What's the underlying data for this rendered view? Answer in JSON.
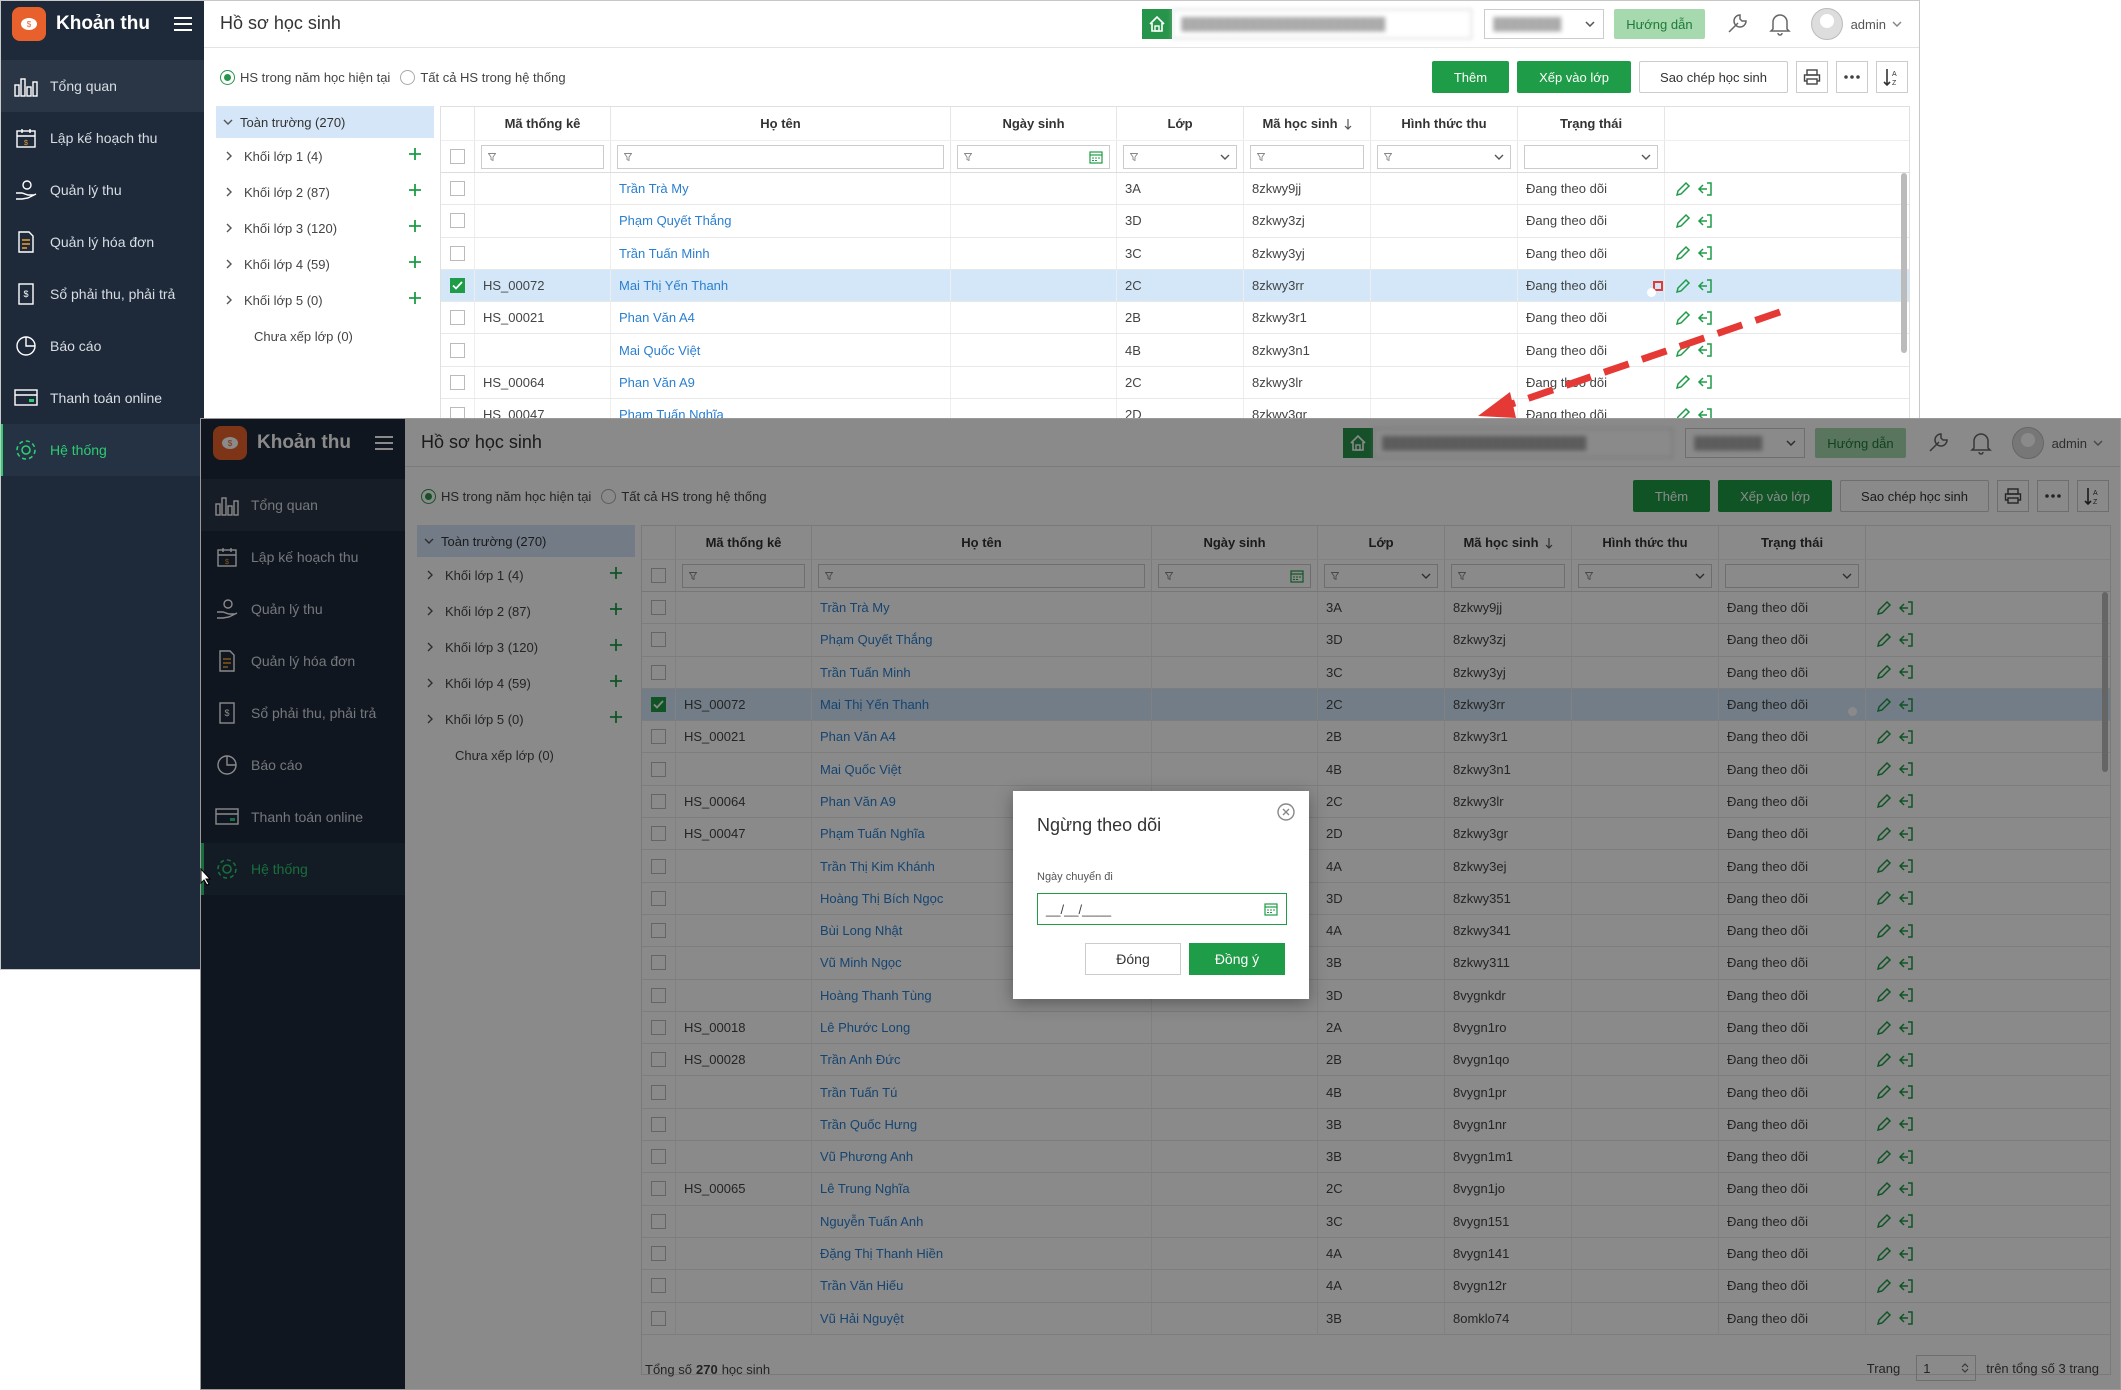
{
  "app": {
    "name": "Khoản thu"
  },
  "nav": [
    {
      "label": "Tổng quan",
      "icon": "bar-chart-icon"
    },
    {
      "label": "Lập kế hoạch thu",
      "icon": "calendar-icon"
    },
    {
      "label": "Quản lý thu",
      "icon": "hand-coin-icon"
    },
    {
      "label": "Quản lý hóa đơn",
      "icon": "invoice-icon"
    },
    {
      "label": "Sổ phải thu, phải trả",
      "icon": "ledger-icon"
    },
    {
      "label": "Báo cáo",
      "icon": "pie-chart-icon"
    },
    {
      "label": "Thanh toán online",
      "icon": "card-icon"
    },
    {
      "label": "Hệ thống",
      "icon": "gear-icon"
    }
  ],
  "header": {
    "title": "Hồ sơ học sinh",
    "guide": "Hướng dẫn",
    "user": "admin"
  },
  "filters": {
    "current_year": "HS trong năm học hiện tại",
    "all": "Tất cả HS trong hệ thống"
  },
  "actions": {
    "add": "Thêm",
    "assign": "Xếp vào lớp",
    "copy": "Sao chép học sinh"
  },
  "tree": {
    "root": "Toàn trường (270)",
    "nodes": [
      "Khối lớp 1 (4)",
      "Khối lớp 2 (87)",
      "Khối lớp 3 (120)",
      "Khối lớp 4 (59)",
      "Khối lớp 5 (0)"
    ],
    "unassigned": "Chưa xếp lớp (0)"
  },
  "columns": [
    "Mã thống kê",
    "Họ tên",
    "Ngày sinh",
    "Lớp",
    "Mã học sinh",
    "Hình thức thu",
    "Trạng thái"
  ],
  "status_text": "Đang theo dõi",
  "rows": [
    {
      "code": "",
      "name": "Trần Trà My",
      "cls": "3A",
      "sid": "8zkwy9jj"
    },
    {
      "code": "",
      "name": "Phạm Quyết Thắng",
      "cls": "3D",
      "sid": "8zkwy3zj"
    },
    {
      "code": "",
      "name": "Trần Tuấn Minh",
      "cls": "3C",
      "sid": "8zkwy3yj"
    },
    {
      "code": "HS_00072",
      "name": "Mai Thị Yến Thanh",
      "cls": "2C",
      "sid": "8zkwy3rr",
      "selected": true
    },
    {
      "code": "HS_00021",
      "name": "Phan Văn A4",
      "cls": "2B",
      "sid": "8zkwy3r1"
    },
    {
      "code": "",
      "name": "Mai Quốc Việt",
      "cls": "4B",
      "sid": "8zkwy3n1"
    },
    {
      "code": "HS_00064",
      "name": "Phan Văn A9",
      "cls": "2C",
      "sid": "8zkwy3lr"
    },
    {
      "code": "HS_00047",
      "name": "Phạm Tuấn Nghĩa",
      "cls": "2D",
      "sid": "8zkwy3gr"
    },
    {
      "code": "",
      "name": "Trần Thị Kim Khánh",
      "cls": "4A",
      "sid": "8zkwy3ej"
    },
    {
      "code": "",
      "name": "Hoàng Thị Bích Ngọc",
      "cls": "3D",
      "sid": "8zkwy351"
    },
    {
      "code": "",
      "name": "Bùi Long Nhật",
      "cls": "4A",
      "sid": "8zkwy341"
    },
    {
      "code": "",
      "name": "Vũ Minh Ngọc",
      "cls": "3B",
      "sid": "8zkwy311"
    },
    {
      "code": "",
      "name": "Hoàng Thanh Tùng",
      "cls": "3D",
      "sid": "8vygnkdr"
    },
    {
      "code": "HS_00018",
      "name": "Lê Phước Long",
      "cls": "2A",
      "sid": "8vygn1ro"
    },
    {
      "code": "HS_00028",
      "name": "Trần Anh Đức",
      "cls": "2B",
      "sid": "8vygn1qo"
    },
    {
      "code": "",
      "name": "Trần Tuấn Tú",
      "cls": "4B",
      "sid": "8vygn1pr"
    },
    {
      "code": "",
      "name": "Trần Quốc Hưng",
      "cls": "3B",
      "sid": "8vygn1nr"
    },
    {
      "code": "",
      "name": "Vũ Phương Anh",
      "cls": "3B",
      "sid": "8vygn1m1"
    },
    {
      "code": "HS_00065",
      "name": "Lê Trung Nghĩa",
      "cls": "2C",
      "sid": "8vygn1jo"
    },
    {
      "code": "",
      "name": "Nguyễn Tuấn Anh",
      "cls": "3C",
      "sid": "8vygn151"
    },
    {
      "code": "",
      "name": "Đặng Thị Thanh Hiền",
      "cls": "4A",
      "sid": "8vygn141"
    },
    {
      "code": "",
      "name": "Trần Văn Hiếu",
      "cls": "4A",
      "sid": "8vygn12r"
    },
    {
      "code": "",
      "name": "Vũ Hải Nguyệt",
      "cls": "3B",
      "sid": "8omklo74"
    }
  ],
  "footer": {
    "prefix": "Tổng số",
    "count": "270",
    "suffix": "học sinh",
    "page_label": "Trang",
    "page": "1",
    "total_pages": "trên tổng số 3 trang"
  },
  "dialog": {
    "title": "Ngừng theo dõi",
    "label": "Ngày chuyển đi",
    "value": "__/__/____",
    "cancel": "Đóng",
    "ok": "Đồng ý"
  },
  "colors": {
    "primary": "#1e9c47",
    "sidebar": "#1e2a3a",
    "link": "#2a7fd0",
    "highlight": "#e53935"
  }
}
